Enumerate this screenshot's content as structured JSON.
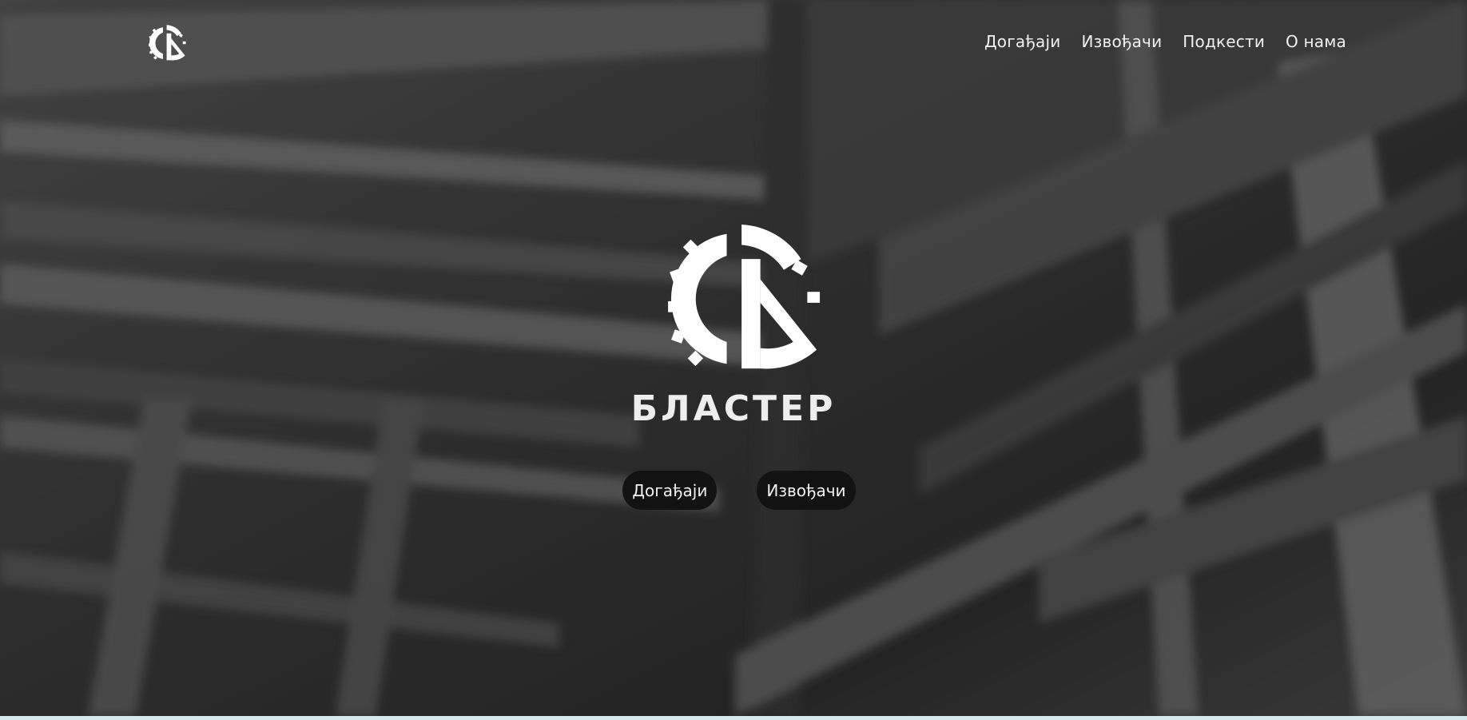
{
  "site": {
    "brand_name": "БЛАСТЕР",
    "logo_icon": "gear-b-logo-icon"
  },
  "nav": {
    "items": [
      {
        "label": "Догађаји"
      },
      {
        "label": "Извођачи"
      },
      {
        "label": "Подкести"
      },
      {
        "label": "О нама"
      }
    ]
  },
  "hero": {
    "background": "blurred-industrial-building-photo",
    "buttons": [
      {
        "label": "Догађаји"
      },
      {
        "label": "Извођачи"
      }
    ]
  },
  "colors": {
    "text": "#f2f2f2",
    "button_bg": "#121212",
    "overlay": "#3c3c3c",
    "bottom_strip": "#d7ebef"
  }
}
